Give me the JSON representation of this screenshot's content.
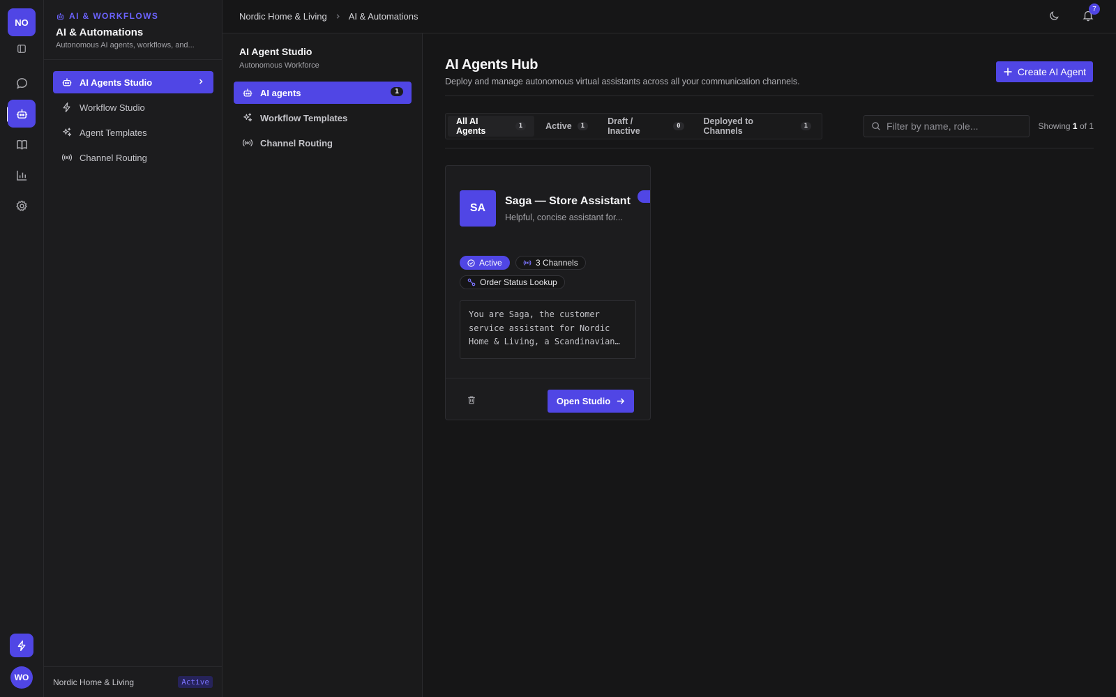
{
  "rail": {
    "org_initials": "NO",
    "user_initials": "WO",
    "icons": [
      "sidebar-toggle-icon",
      "chat-icon",
      "robot-icon",
      "book-icon",
      "bar-chart-icon",
      "gear-icon",
      "bolt-icon"
    ]
  },
  "sidebar": {
    "eyebrow": "AI & WORKFLOWS",
    "title": "AI & Automations",
    "subtitle": "Autonomous AI agents, workflows, and...",
    "items": [
      {
        "label": "AI Agents Studio",
        "icon": "robot-icon",
        "active": true
      },
      {
        "label": "Workflow Studio",
        "icon": "bolt-icon"
      },
      {
        "label": "Agent Templates",
        "icon": "sparkles-icon"
      },
      {
        "label": "Channel Routing",
        "icon": "broadcast-icon"
      }
    ],
    "footer": {
      "workspace": "Nordic Home & Living",
      "status": "Active"
    }
  },
  "topbar": {
    "breadcrumb": [
      "Nordic Home & Living",
      "AI & Automations"
    ],
    "notifications_count": "7"
  },
  "studio": {
    "title": "AI Agent Studio",
    "subtitle": "Autonomous Workforce",
    "items": [
      {
        "label": "AI agents",
        "count": "1",
        "active": true
      },
      {
        "label": "Workflow Templates"
      },
      {
        "label": "Channel Routing"
      }
    ]
  },
  "main": {
    "title": "AI Agents Hub",
    "description": "Deploy and manage autonomous virtual assistants across all your communication channels.",
    "create_label": "Create AI Agent",
    "tabs": [
      {
        "label": "All AI Agents",
        "count": "1"
      },
      {
        "label": "Active",
        "count": "1"
      },
      {
        "label": "Draft / Inactive",
        "count": "0"
      },
      {
        "label": "Deployed to Channels",
        "count": "1"
      }
    ],
    "search_placeholder": "Filter by name, role...",
    "showing": {
      "prefix": "Showing",
      "current": "1",
      "sep": "of",
      "total": "1"
    }
  },
  "agent": {
    "initials": "SA",
    "name": "Saga — Store Assistant",
    "role": "Helpful, concise assistant for...",
    "enabled": true,
    "status": "Active",
    "channels": "3 Channels",
    "tool": "Order Status Lookup",
    "prompt": "You are Saga, the customer service assistant for Nordic Home & Living, a Scandinavian home furnishings retailer.",
    "open_label": "Open Studio"
  },
  "colors": {
    "accent": "#5046e5",
    "bg": "#161617",
    "panel": "#1c1c1e"
  }
}
